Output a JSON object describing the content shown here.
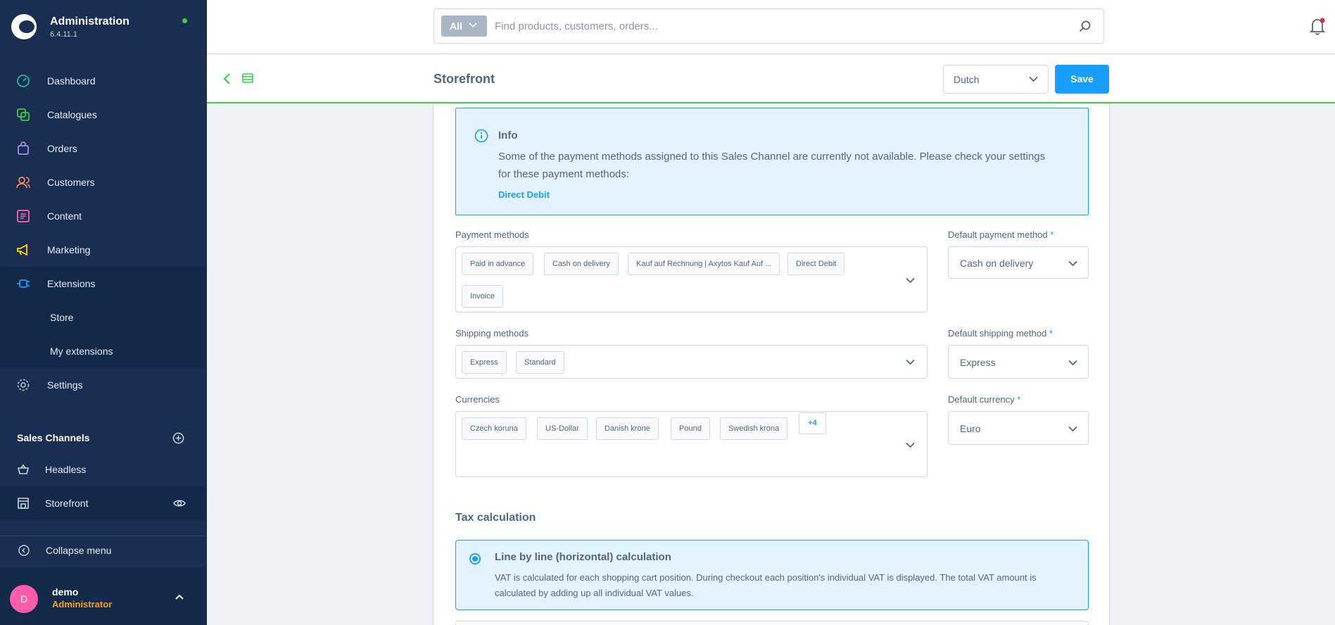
{
  "brand": {
    "title": "Administration",
    "version": "6.4.11.1"
  },
  "nav": {
    "dashboard": "Dashboard",
    "catalogues": "Catalogues",
    "orders": "Orders",
    "customers": "Customers",
    "content": "Content",
    "marketing": "Marketing",
    "extensions": "Extensions",
    "store": "Store",
    "my_extensions": "My extensions",
    "settings": "Settings"
  },
  "sales_channels": {
    "title": "Sales Channels",
    "headless": "Headless",
    "storefront": "Storefront"
  },
  "collapse_menu": "Collapse menu",
  "user": {
    "initial": "D",
    "name": "demo",
    "role": "Administrator"
  },
  "search": {
    "type": "All",
    "placeholder": "Find products, customers, orders..."
  },
  "smartbar": {
    "title": "Storefront",
    "language": "Dutch",
    "save": "Save"
  },
  "alert": {
    "title": "Info",
    "text": "Some of the payment methods assigned to this Sales Channel are currently not available. Please check your settings for these payment methods:",
    "link": "Direct Debit"
  },
  "payment": {
    "label": "Payment methods",
    "tags": [
      "Paid in advance",
      "Cash on delivery",
      "Kauf auf Rechnung | Axytos Kauf Auf ...",
      "Direct Debit",
      "Invoice"
    ],
    "default_label": "Default payment method",
    "default_value": "Cash on delivery"
  },
  "shipping": {
    "label": "Shipping methods",
    "tags": [
      "Express",
      "Standard"
    ],
    "default_label": "Default shipping method",
    "default_value": "Express"
  },
  "currencies": {
    "label": "Currencies",
    "tags": [
      "Czech koruna",
      "US-Dollar",
      "Danish krone",
      "Pound",
      "Swedish krona"
    ],
    "more": "+4",
    "default_label": "Default currency",
    "default_value": "Euro"
  },
  "required_marker": "*",
  "tax": {
    "title": "Tax calculation",
    "option_title": "Line by line (horizontal) calculation",
    "option_desc": "VAT is calculated for each shopping cart position. During checkout each position's individual VAT is displayed. The total VAT amount is calculated by adding up all individual VAT values."
  },
  "colors": {
    "sidebar": "#1a2e52",
    "accent": "#189eff",
    "success": "#37d046",
    "avatar": "#ff5dac",
    "role": "#ff9f1c"
  }
}
